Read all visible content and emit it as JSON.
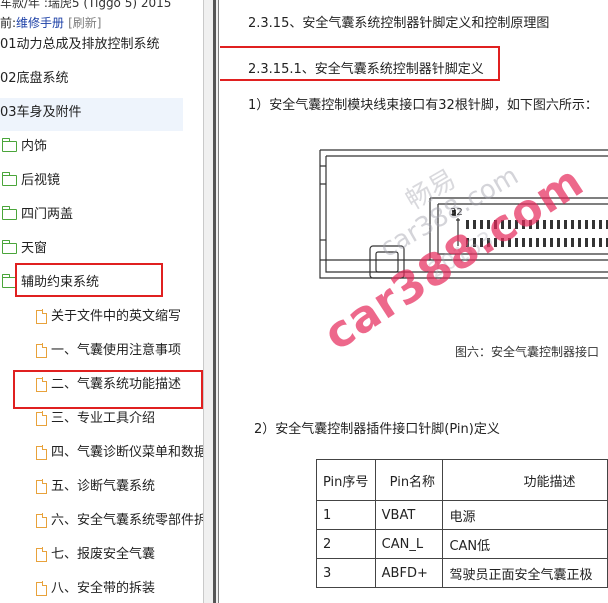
{
  "left_panel": {
    "top_partial": "车款/年 :瑞虎5 (Tiggo 5) 2015",
    "top_prefix": "前:",
    "manual_label": "维修手册",
    "refresh_label": "[刷新]",
    "items": [
      {
        "label": "01动力总成及排放控制系统"
      },
      {
        "label": "02底盘系统"
      },
      {
        "label": "03车身及附件"
      },
      {
        "label": "内饰"
      },
      {
        "label": "后视镜"
      },
      {
        "label": "四门两盖"
      },
      {
        "label": "天窗"
      },
      {
        "label": "辅助约束系统"
      },
      {
        "label": "关于文件中的英文缩写"
      },
      {
        "label": "一、气囊使用注意事项"
      },
      {
        "label": "二、气囊系统功能描述"
      },
      {
        "label": "三、专业工具介绍"
      },
      {
        "label": "四、气囊诊断仪菜单和数据"
      },
      {
        "label": "五、诊断气囊系统"
      },
      {
        "label": "六、安全气囊系统零部件拆"
      },
      {
        "label": "七、报废安全气囊"
      },
      {
        "label": "八、安全带的拆装"
      }
    ]
  },
  "document": {
    "section_title": "2.3.15、安全气囊系统控制器针脚定义和控制原理图",
    "subsection_title": "2.3.15.1、安全气囊系统控制器针脚定义",
    "para1": "1）安全气囊控制模块线束接口有32根针脚，如下图六所示：",
    "connector_pin_label": "32",
    "figure_caption": "图六：安全气囊控制器接口",
    "para2": "2）安全气囊控制器插件接口针脚(Pin)定义",
    "table": {
      "headers": [
        "Pin序号",
        "Pin名称",
        "功能描述"
      ],
      "rows": [
        [
          "1",
          "VBAT",
          "电源"
        ],
        [
          "2",
          "CAN_L",
          "CAN低"
        ],
        [
          "3",
          "ABFD+",
          "驾驶员正面安全气囊正极"
        ]
      ]
    }
  },
  "watermarks": {
    "main": "car388.com",
    "secondary": "car388.com",
    "chinese": "畅易",
    "number": "20163"
  },
  "colors": {
    "highlight": "#e02020",
    "folder": "#4aa53a",
    "doc_icon": "#e8a23b",
    "link": "#1b3fa6"
  }
}
